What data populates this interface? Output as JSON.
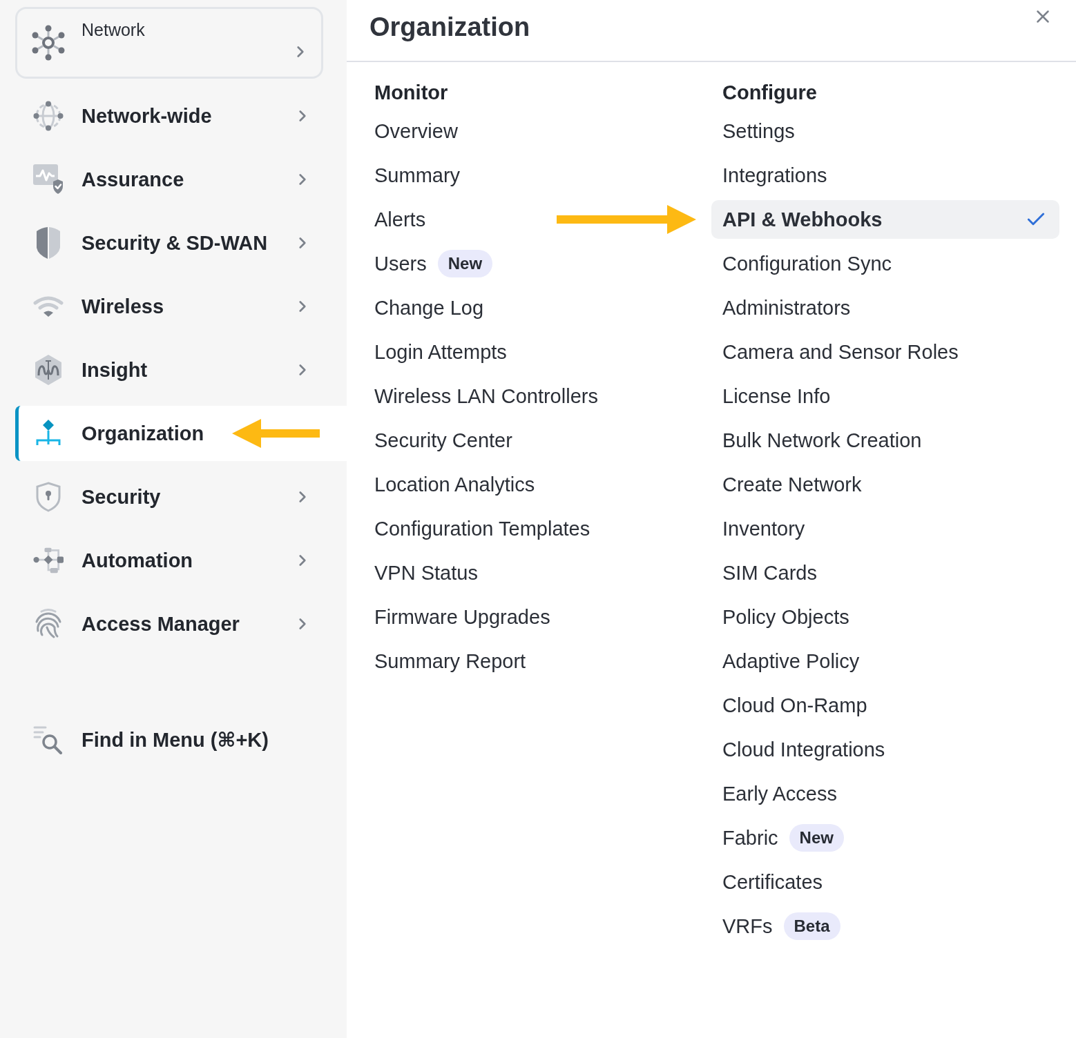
{
  "sidebar": {
    "network_selector": {
      "label": "Network"
    },
    "items": [
      {
        "label": "Network-wide",
        "selected": false,
        "submenu": true,
        "arrow": false
      },
      {
        "label": "Assurance",
        "selected": false,
        "submenu": true,
        "arrow": false
      },
      {
        "label": "Security & SD-WAN",
        "selected": false,
        "submenu": true,
        "arrow": false
      },
      {
        "label": "Wireless",
        "selected": false,
        "submenu": true,
        "arrow": false
      },
      {
        "label": "Insight",
        "selected": false,
        "submenu": true,
        "arrow": false
      },
      {
        "label": "Organization",
        "selected": true,
        "submenu": false,
        "arrow": true
      },
      {
        "label": "Security",
        "selected": false,
        "submenu": true,
        "arrow": false
      },
      {
        "label": "Automation",
        "selected": false,
        "submenu": true,
        "arrow": false
      },
      {
        "label": "Access Manager",
        "selected": false,
        "submenu": true,
        "arrow": false
      }
    ],
    "find": {
      "label": "Find in Menu (⌘+K)"
    }
  },
  "panel": {
    "title": "Organization",
    "columns": [
      {
        "heading": "Monitor",
        "items": [
          {
            "label": "Overview",
            "selected": false,
            "arrow": false
          },
          {
            "label": "Summary",
            "selected": false,
            "arrow": false
          },
          {
            "label": "Alerts",
            "selected": false,
            "arrow": false
          },
          {
            "label": "Users",
            "badge": "New",
            "selected": false,
            "arrow": false
          },
          {
            "label": "Change Log",
            "selected": false,
            "arrow": false
          },
          {
            "label": "Login Attempts",
            "selected": false,
            "arrow": false
          },
          {
            "label": "Wireless LAN Controllers",
            "selected": false,
            "arrow": false
          },
          {
            "label": "Security Center",
            "selected": false,
            "arrow": false
          },
          {
            "label": "Location Analytics",
            "selected": false,
            "arrow": false
          },
          {
            "label": "Configuration Templates",
            "selected": false,
            "arrow": false
          },
          {
            "label": "VPN Status",
            "selected": false,
            "arrow": false
          },
          {
            "label": "Firmware Upgrades",
            "selected": false,
            "arrow": false
          },
          {
            "label": "Summary Report",
            "selected": false,
            "arrow": false
          }
        ]
      },
      {
        "heading": "Configure",
        "items": [
          {
            "label": "Settings",
            "selected": false,
            "arrow": false
          },
          {
            "label": "Integrations",
            "selected": false,
            "arrow": false
          },
          {
            "label": "API & Webhooks",
            "selected": true,
            "arrow": true
          },
          {
            "label": "Configuration Sync",
            "selected": false,
            "arrow": false
          },
          {
            "label": "Administrators",
            "selected": false,
            "arrow": false
          },
          {
            "label": "Camera and Sensor Roles",
            "selected": false,
            "arrow": false
          },
          {
            "label": "License Info",
            "selected": false,
            "arrow": false
          },
          {
            "label": "Bulk Network Creation",
            "selected": false,
            "arrow": false
          },
          {
            "label": "Create Network",
            "selected": false,
            "arrow": false
          },
          {
            "label": "Inventory",
            "selected": false,
            "arrow": false
          },
          {
            "label": "SIM Cards",
            "selected": false,
            "arrow": false
          },
          {
            "label": "Policy Objects",
            "selected": false,
            "arrow": false
          },
          {
            "label": "Adaptive Policy",
            "selected": false,
            "arrow": false
          },
          {
            "label": "Cloud On-Ramp",
            "selected": false,
            "arrow": false
          },
          {
            "label": "Cloud Integrations",
            "selected": false,
            "arrow": false
          },
          {
            "label": "Early Access",
            "selected": false,
            "arrow": false
          },
          {
            "label": "Fabric",
            "badge": "New",
            "selected": false,
            "arrow": false
          },
          {
            "label": "Certificates",
            "selected": false,
            "arrow": false
          },
          {
            "label": "VRFs",
            "badge": "Beta",
            "selected": false,
            "arrow": false
          }
        ]
      }
    ]
  }
}
